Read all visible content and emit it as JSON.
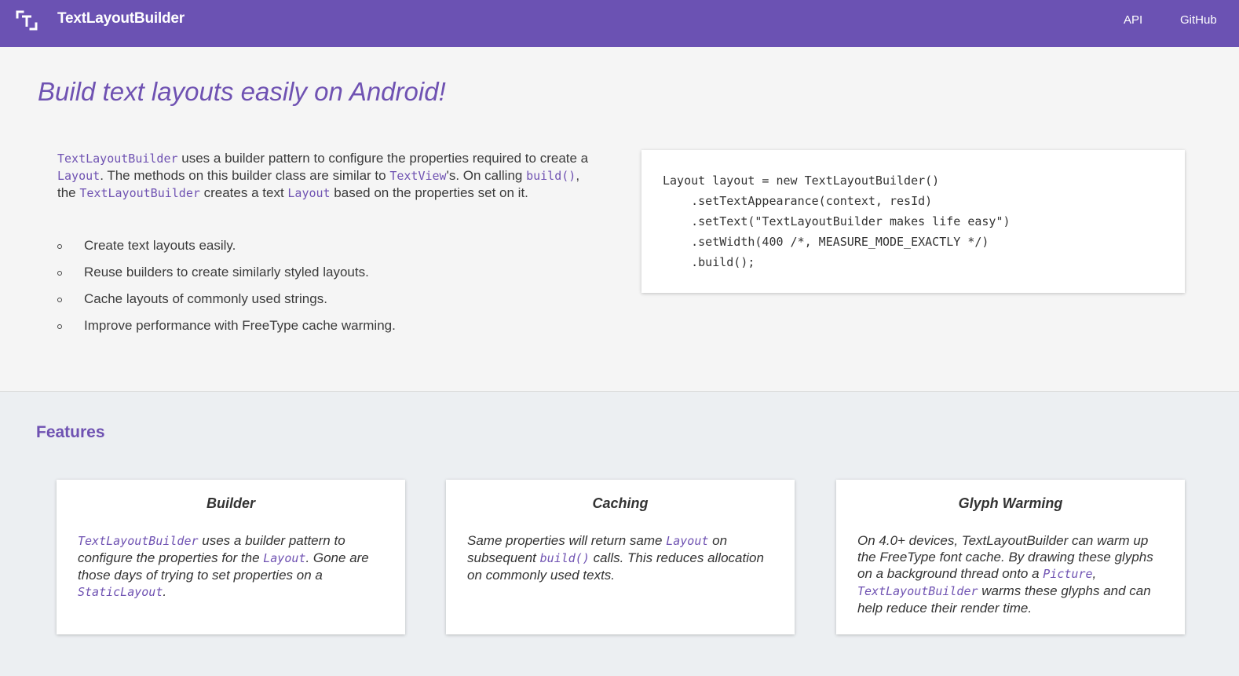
{
  "header": {
    "brand": "TextLayoutBuilder",
    "nav": {
      "api": "API",
      "github": "GitHub"
    }
  },
  "hero": {
    "title": "Build text layouts easily on Android!",
    "intro": {
      "class_name": "TextLayoutBuilder",
      "t1": " uses a builder pattern to configure the properties required to create a ",
      "layout_class": "Layout",
      "t2": ". The methods on this builder class are similar to ",
      "textview_class": "TextView",
      "t3": "'s. On calling ",
      "build_call": "build()",
      "t4": ", the ",
      "t5": " creates a text ",
      "t6": " based on the properties set on it."
    },
    "bullets": [
      "Create text layouts easily.",
      "Reuse builders to create similarly styled layouts.",
      "Cache layouts of commonly used strings.",
      "Improve performance with FreeType cache warming."
    ],
    "code_lines": [
      "Layout layout = new TextLayoutBuilder()",
      "    .setTextAppearance(context, resId)",
      "    .setText(\"TextLayoutBuilder makes life easy\")",
      "    .setWidth(400 /*, MEASURE_MODE_EXACTLY */)",
      "    .build();"
    ]
  },
  "features": {
    "title": "Features",
    "builder": {
      "title": "Builder",
      "class_name": "TextLayoutBuilder",
      "t1": " uses a builder pattern to configure the properties for the ",
      "layout_class": "Layout",
      "t2": ". Gone are those days of trying to set properties on a ",
      "static_layout": "StaticLayout",
      "t3": "."
    },
    "caching": {
      "title": "Caching",
      "t1": "Same properties will return same ",
      "layout_class": "Layout",
      "t2": " on subsequent ",
      "build_call": "build()",
      "t3": " calls. This reduces allocation on commonly used texts."
    },
    "glyph": {
      "title": "Glyph Warming",
      "t1": "On 4.0+ devices, TextLayoutBuilder can warm up the FreeType font cache. By drawing these glyphs on a background thread onto a ",
      "picture_class": "Picture",
      "t2": ", ",
      "class_name": "TextLayoutBuilder",
      "t3": " warms these glyphs and can help reduce their render time."
    }
  },
  "colors": {
    "brand": "#6b52b3",
    "accent_text": "#6f52b2",
    "page_bg": "#f5f5f5",
    "features_bg": "#eceff2"
  },
  "icons": {
    "logo": "text-bracket-logo-icon",
    "bullet": "circle-bullet-icon"
  }
}
